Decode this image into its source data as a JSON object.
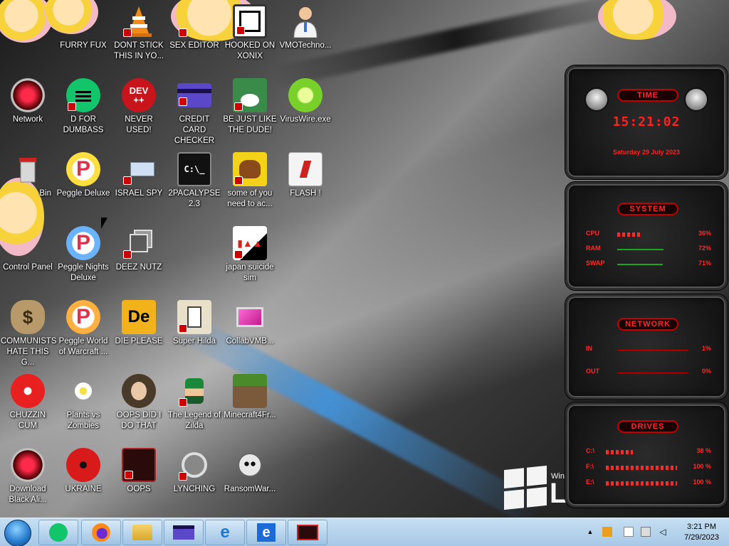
{
  "desktop": {
    "icons": [
      {
        "label": "FURRY FUX"
      },
      {
        "label": "DONT STICK THIS IN YO..."
      },
      {
        "label": "SEX EDITOR"
      },
      {
        "label": "HOOKED ON XONIX"
      },
      {
        "label": "VMOTechno..."
      },
      {
        "label": "Network"
      },
      {
        "label": "D FOR DUMBASS"
      },
      {
        "label": "NEVER USED!"
      },
      {
        "label": "CREDIT CARD CHECKER"
      },
      {
        "label": "BE JUST LIKE THE DUDE!"
      },
      {
        "label": "VirusWire.exe"
      },
      {
        "label": "Bin"
      },
      {
        "label": "Peggle Deluxe"
      },
      {
        "label": "ISRAEL SPY"
      },
      {
        "label": "2PACALYPSE 2.3"
      },
      {
        "label": "some of you need to ac..."
      },
      {
        "label": "FLASH !"
      },
      {
        "label": "Control Panel"
      },
      {
        "label": "Peggle Nights Deluxe"
      },
      {
        "label": "DEEZ NUTZ"
      },
      {
        "label": "japan suicide sim"
      },
      {
        "label": "COMMUNISTS HATE THIS G..."
      },
      {
        "label": "Peggle World of Warcraft ..."
      },
      {
        "label": "DIE PLEASE"
      },
      {
        "label": "Super Hilda"
      },
      {
        "label": "CollabVMB..."
      },
      {
        "label": "CHUZZIN CUM"
      },
      {
        "label": "Plants vs Zombies"
      },
      {
        "label": "OOPS DID I DO THAT"
      },
      {
        "label": "The Legend of Zilda"
      },
      {
        "label": "Minecraft4Fr..."
      },
      {
        "label": "Download Black Ali..."
      },
      {
        "label": "UKRAINE"
      },
      {
        "label": "OOPS"
      },
      {
        "label": "LYNCHING"
      },
      {
        "label": "RansomWar..."
      }
    ],
    "icon_glyphs": {
      "dev": "DEV\n++",
      "de": "De",
      "dollar": "$",
      "cmd": "C:\\_",
      "peggle": "P"
    },
    "branding": {
      "small": "Win",
      "large": "LO"
    }
  },
  "widgets": {
    "time": {
      "title": "TIME",
      "time": "15:21:02",
      "date": "Saturday 29 July 2023"
    },
    "system": {
      "title": "SYSTEM",
      "rows": [
        {
          "key": "CPU",
          "value": "36%",
          "fraction": 0.36
        },
        {
          "key": "RAM",
          "value": "72%",
          "fraction": 0.72
        },
        {
          "key": "SWAP",
          "value": "71%",
          "fraction": 0.71
        }
      ]
    },
    "network": {
      "title": "NETWORK",
      "rows": [
        {
          "key": "IN",
          "value": "1%"
        },
        {
          "key": "OUT",
          "value": "0%"
        }
      ]
    },
    "drives": {
      "title": "DRIVES",
      "rows": [
        {
          "key": "C:\\",
          "value": "38 %",
          "fraction": 0.38
        },
        {
          "key": "F:\\",
          "value": "100 %",
          "fraction": 1.0
        },
        {
          "key": "E:\\",
          "value": "100 %",
          "fraction": 1.0
        }
      ]
    }
  },
  "taskbar": {
    "clock": {
      "time": "3:21 PM",
      "date": "7/29/2023"
    },
    "tray_arrow": "▲",
    "colors": {
      "accent": "#c10000",
      "taskbar": "#b8d4ee"
    }
  }
}
